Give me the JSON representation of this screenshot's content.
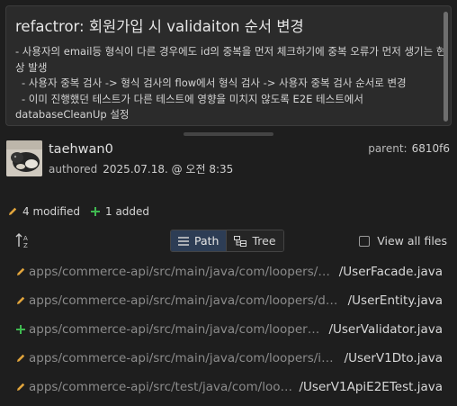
{
  "commit": {
    "title": "refactror: 회원가입 시 validaiton 순서 변경",
    "body": [
      "- 사용자의 email등 형식이 다른 경우에도 id의 중복을 먼저 체크하기에 중복 오류가 먼저 생기는 현",
      "상 발생",
      "  - 사용자 중복 검사 -> 형식 검사의 flow에서 형식 검사 -> 사용자 중복 검사 순서로 변경",
      "  - 이미 진행했던 테스트가 다른 테스트에 영향을 미치지 않도록 E2E 테스트에서",
      "databaseCleanUp 설정"
    ]
  },
  "author": {
    "name": "taehwan0",
    "authored_label": "authored",
    "date": "2025.07.18. @ 오전 8:35"
  },
  "parent": {
    "label": "parent:",
    "hash": "6810f6"
  },
  "summary": {
    "modified": "4 modified",
    "added": "1 added"
  },
  "view": {
    "path_label": "Path",
    "tree_label": "Tree",
    "view_all_label": "View all files"
  },
  "colors": {
    "modified": "#e2a53c",
    "added": "#3fb950",
    "accent": "#2d3d55"
  },
  "files": [
    {
      "status": "modified",
      "icon": "pencil-icon",
      "dir": "apps/commerce-api/src/main/java/com/loopers/ap...",
      "name": "/UserFacade.java"
    },
    {
      "status": "modified",
      "icon": "pencil-icon",
      "dir": "apps/commerce-api/src/main/java/com/loopers/do...",
      "name": "/UserEntity.java"
    },
    {
      "status": "added",
      "icon": "plus-icon",
      "dir": "apps/commerce-api/src/main/java/com/loopers/...",
      "name": "/UserValidator.java"
    },
    {
      "status": "modified",
      "icon": "pencil-icon",
      "dir": "apps/commerce-api/src/main/java/com/loopers/inte...",
      "name": "/UserV1Dto.java"
    },
    {
      "status": "modified",
      "icon": "pencil-icon",
      "dir": "apps/commerce-api/src/test/java/com/loope...",
      "name": "/UserV1ApiE2ETest.java"
    }
  ]
}
